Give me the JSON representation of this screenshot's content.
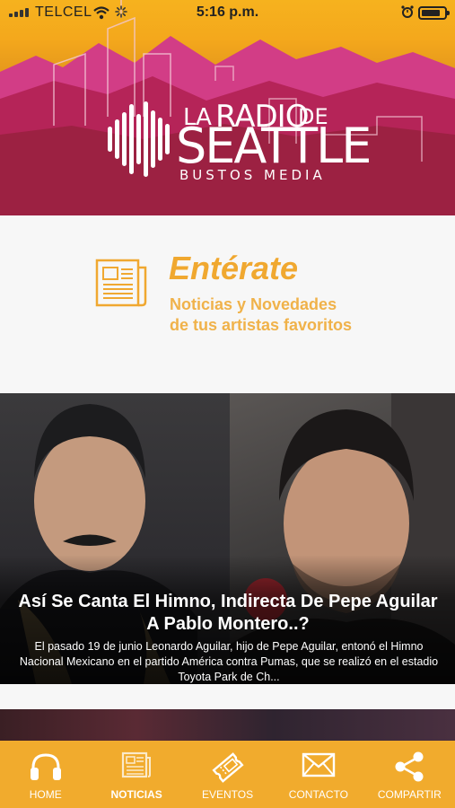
{
  "status_bar": {
    "carrier": "TELCEL",
    "time": "5:16 p.m."
  },
  "header": {
    "logo": {
      "la": "LA",
      "radio": "RADIO",
      "de": "DE",
      "seattle": "SEATTLE",
      "tagline": "BUSTOS MEDIA"
    }
  },
  "section": {
    "title": "Entérate",
    "subtitle_line1": "Noticias y Novedades",
    "subtitle_line2": "de tus artistas favoritos",
    "icon": "newspaper-icon"
  },
  "article": {
    "title": "Así Se Canta El Himno, Indirecta De Pepe Aguilar A Pablo Montero..?",
    "excerpt": "El pasado 19 de junio Leonardo Aguilar, hijo de Pepe Aguilar, entonó el Himno Nacional Mexicano en el partido América contra Pumas, que se realizó en el estadio Toyota Park de Ch..."
  },
  "tabs": [
    {
      "label": "HOME",
      "icon": "headphones-icon",
      "active": false
    },
    {
      "label": "NOTICIAS",
      "icon": "newspaper-icon",
      "active": true
    },
    {
      "label": "EVENTOS",
      "icon": "ticket-icon",
      "active": false
    },
    {
      "label": "CONTACTO",
      "icon": "envelope-icon",
      "active": false
    },
    {
      "label": "COMPARTIR",
      "icon": "share-icon",
      "active": false
    }
  ],
  "colors": {
    "accent": "#f1ab2d",
    "section_title": "#f0a830",
    "banner_magenta": "#a8284e"
  }
}
